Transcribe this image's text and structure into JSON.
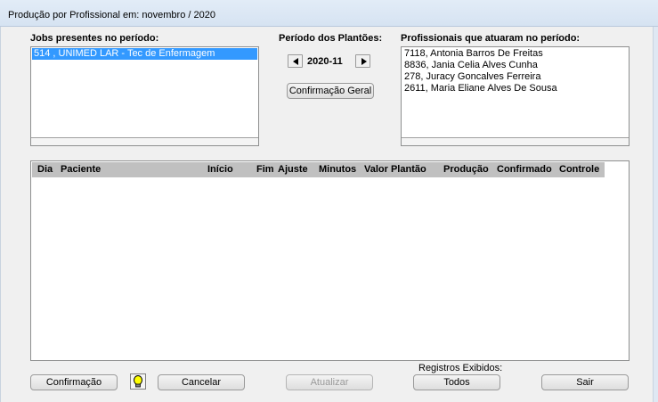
{
  "window": {
    "title": "Produção por Profissional em: novembro / 2020"
  },
  "jobs": {
    "label": "Jobs presentes no período:",
    "items": [
      {
        "text": "514 ,  UNIMED LAR - Tec de Enfermagem",
        "selected": true
      }
    ]
  },
  "period": {
    "label": "Período dos Plantões:",
    "value": "2020-11",
    "confirm_all_label": "Confirmação Geral"
  },
  "professionals": {
    "label": "Profissionais que atuaram no período:",
    "items": [
      "7118, Antonia Barros De Freitas",
      "8836, Jania Celia Alves Cunha",
      "278, Juracy Goncalves Ferreira",
      "2611, Maria Eliane Alves De Sousa"
    ]
  },
  "grid": {
    "columns": [
      "Dia",
      "Paciente",
      "Início",
      "Fim",
      "Ajuste",
      "Minutos",
      "Valor Plantão",
      "Produção",
      "Confirmado",
      "Controle"
    ],
    "rows": []
  },
  "footer": {
    "records_label": "Registros Exibidos:",
    "confirm_label": "Confirmação",
    "cancel_label": "Cancelar",
    "refresh_label": "Atualizar",
    "all_label": "Todos",
    "exit_label": "Sair"
  },
  "colors": {
    "selection": "#3399ff",
    "header_bg": "#c0c0c0",
    "bulb": "#ffff00"
  }
}
